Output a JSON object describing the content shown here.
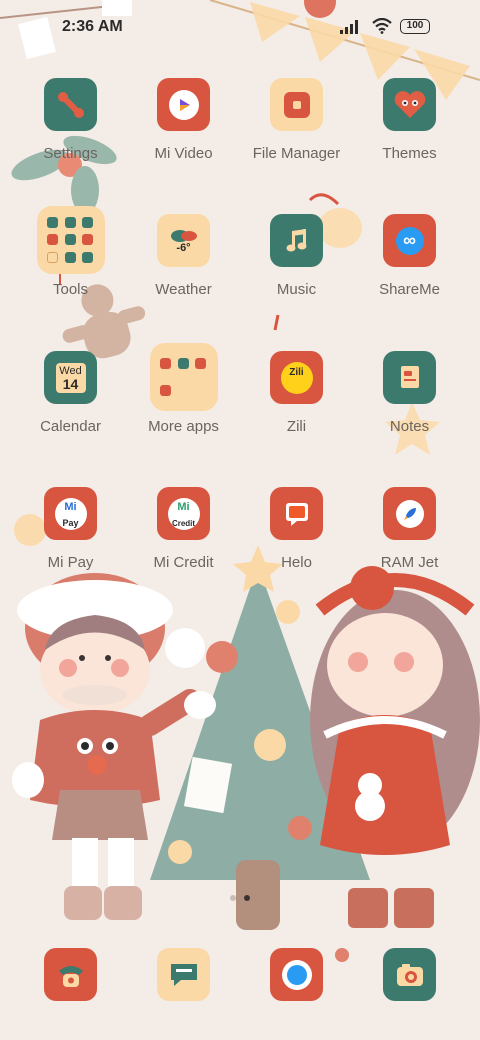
{
  "status_bar": {
    "time": "2:36 AM",
    "battery": "100"
  },
  "apps": [
    {
      "label": "Settings",
      "icon": "wrench-icon"
    },
    {
      "label": "Mi Video",
      "icon": "play-icon"
    },
    {
      "label": "File Manager",
      "icon": "folder-box-icon"
    },
    {
      "label": "Themes",
      "icon": "heart-face-icon"
    },
    {
      "label": "Tools",
      "icon": "folder-icon"
    },
    {
      "label": "Weather",
      "icon": "cloud-icon",
      "temperature": "-6°"
    },
    {
      "label": "Music",
      "icon": "music-note-icon"
    },
    {
      "label": "ShareMe",
      "icon": "infinity-icon"
    },
    {
      "label": "Calendar",
      "icon": "calendar-icon",
      "day_name": "Wed",
      "day_number": "14"
    },
    {
      "label": "More apps",
      "icon": "folder-icon"
    },
    {
      "label": "Zili",
      "icon": "zili-icon",
      "badge": "Zili"
    },
    {
      "label": "Notes",
      "icon": "note-icon"
    },
    {
      "label": "Mi Pay",
      "icon": "mi-pay-icon",
      "badge": "Pay"
    },
    {
      "label": "Mi Credit",
      "icon": "mi-credit-icon",
      "badge": "Credit"
    },
    {
      "label": "Helo",
      "icon": "helo-icon"
    },
    {
      "label": "RAM Jet",
      "icon": "rocket-icon"
    }
  ],
  "dock": [
    {
      "name": "phone",
      "icon": "phone-icon"
    },
    {
      "name": "messaging",
      "icon": "message-icon"
    },
    {
      "name": "browser",
      "icon": "browser-icon"
    },
    {
      "name": "camera",
      "icon": "camera-icon"
    }
  ],
  "colors": {
    "background": "#f4ece6",
    "red": "#d8553f",
    "teal": "#3c7a6e",
    "yellow": "#fbd9a6",
    "label": "#6b6461"
  }
}
